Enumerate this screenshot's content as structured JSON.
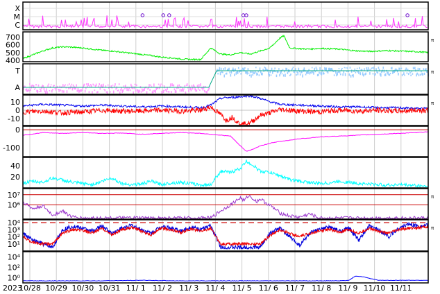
{
  "chart_data": {
    "type": "line",
    "x_axis": {
      "year_label": "2023",
      "tick_labels": [
        "10/28",
        "10/29",
        "10/30",
        "10/31",
        "11/ 1",
        "11/ 2",
        "11/ 3",
        "11/ 4",
        "11/ 5",
        "11/ 6",
        "11/ 7",
        "11/ 8",
        "11/ 9",
        "11/10",
        "11/11"
      ],
      "range": [
        "2023-10-27",
        "2023-11-11 12:00"
      ]
    },
    "grid": true,
    "panels": [
      {
        "id": "xray-flare-class",
        "type": "line",
        "tick_labels": [
          "X",
          "M",
          "C"
        ],
        "right_label": "",
        "colors": {
          "line": "#ff33ff",
          "marker": "#6600cc"
        },
        "flare_markers_x": [
          6.05,
          7.1,
          7.4,
          11.15,
          11.3,
          19.45
        ],
        "series": [
          {
            "name": "",
            "y_level": "C",
            "peaks_above_c": true
          }
        ]
      },
      {
        "id": "solar-wind-speed",
        "type": "line",
        "tick_labels": [
          "700",
          "600",
          "500",
          "400"
        ],
        "ylim": [
          380,
          770
        ],
        "right_label": "π",
        "colors": {
          "line": "#00ee00"
        },
        "series": [
          {
            "name": "",
            "x": [
              0,
              0.5,
              1.0,
              1.5,
              2.0,
              2.5,
              3.0,
              3.5,
              4.0,
              4.5,
              5.0,
              5.5,
              6.0,
              6.5,
              7.0,
              7.5,
              8.0,
              8.5,
              9.0,
              9.5,
              10.0,
              10.5,
              11.0,
              11.5,
              12.0,
              12.5,
              13.0,
              13.2,
              13.5,
              14.0,
              14.5,
              15.0,
              15.5,
              16.0,
              16.5,
              17.0,
              17.5,
              18.0,
              18.5,
              19.0,
              19.5,
              20.0,
              20.5
            ],
            "y": [
              420,
              470,
              520,
              560,
              575,
              570,
              560,
              545,
              530,
              520,
              505,
              490,
              475,
              460,
              440,
              430,
              415,
              410,
              410,
              560,
              480,
              470,
              500,
              480,
              520,
              560,
              690,
              720,
              560,
              550,
              545,
              555,
              550,
              545,
              530,
              520,
              515,
              520,
              525,
              520,
              515,
              510,
              500
            ]
          }
        ]
      },
      {
        "id": "imf-sector",
        "type": "scatter",
        "tick_labels": [
          "T",
          "A"
        ],
        "right_label": "π",
        "colors": {
          "t": "#99ccff",
          "a": "#ff99ff",
          "boundary": "#00aa88"
        },
        "series": [
          {
            "name": "",
            "x_range": [
              0,
              9.4
            ],
            "level": "A"
          },
          {
            "name": "",
            "x_range": [
              9.8,
              20.5
            ],
            "level": "T"
          }
        ]
      },
      {
        "id": "imf-components",
        "type": "line",
        "tick_labels": [
          "10",
          "0",
          "-10"
        ],
        "ylim": [
          -18,
          18
        ],
        "right_label": "π",
        "colors": {
          "total": "#0000ee",
          "bz": "#ff0000"
        },
        "series": [
          {
            "name": "",
            "x": [
              0,
              1,
              2,
              3,
              4,
              5,
              6,
              7,
              8,
              9,
              9.5,
              10,
              10.3,
              10.6,
              11,
              11.5,
              12,
              12.5,
              13,
              14,
              15,
              16,
              17,
              18,
              19,
              20,
              20.5
            ],
            "y": [
              5,
              7,
              6,
              5,
              6,
              5,
              4,
              5,
              4,
              3,
              6,
              14,
              15,
              15,
              16,
              17,
              14,
              10,
              7,
              6,
              5,
              4,
              4,
              3,
              3,
              2,
              2
            ]
          },
          {
            "name": "",
            "x": [
              0,
              1,
              2,
              3,
              4,
              5,
              6,
              7,
              8,
              9,
              9.5,
              10,
              10.3,
              10.6,
              11,
              11.5,
              12,
              12.5,
              13,
              14,
              15,
              16,
              17,
              18,
              19,
              20,
              20.5
            ],
            "y": [
              -2,
              -1,
              -3,
              -2,
              0,
              -1,
              -1,
              0,
              -1,
              0,
              4,
              -5,
              -12,
              -8,
              -17,
              -15,
              -6,
              -3,
              1,
              -1,
              -2,
              0,
              -1,
              0,
              -1,
              0,
              0
            ]
          }
        ]
      },
      {
        "id": "dst-index",
        "type": "line",
        "tick_labels": [
          "0",
          "-100"
        ],
        "ylim": [
          -150,
          20
        ],
        "right_label": "",
        "colors": {
          "line": "#ff00ff",
          "zero_line": "#cc0000"
        },
        "series": [
          {
            "name": "",
            "x": [
              0,
              0.5,
              1,
              2,
              3,
              4,
              5,
              6,
              7,
              8,
              9,
              9.5,
              10,
              10.5,
              11,
              11.3,
              11.6,
              12,
              12.5,
              13,
              14,
              15,
              16,
              17,
              18,
              19,
              20,
              20.5
            ],
            "y": [
              -30,
              -25,
              -15,
              -20,
              -15,
              -20,
              -18,
              -25,
              -20,
              -15,
              -20,
              -25,
              -30,
              -35,
              -90,
              -120,
              -110,
              -90,
              -75,
              -65,
              -50,
              -40,
              -35,
              -30,
              -25,
              -20,
              -15,
              -10
            ]
          }
        ]
      },
      {
        "id": "kp-like",
        "type": "line",
        "tick_labels": [
          "40",
          "20"
        ],
        "ylim": [
          0,
          55
        ],
        "right_label": "",
        "colors": {
          "line": "#00ffff"
        },
        "series": [
          {
            "name": "",
            "x": [
              0,
              0.5,
              1,
              1.5,
              2,
              2.5,
              3,
              3.5,
              4,
              4.5,
              5,
              5.5,
              6,
              6.5,
              7,
              7.5,
              8,
              8.5,
              9,
              9.5,
              10,
              10.5,
              11,
              11.3,
              11.6,
              12,
              12.5,
              13,
              13.5,
              14,
              14.5,
              15,
              15.5,
              16,
              16.5,
              17,
              17.5,
              18,
              18.5,
              19,
              19.5,
              20,
              20.5
            ],
            "y": [
              8,
              12,
              10,
              18,
              14,
              10,
              8,
              6,
              12,
              18,
              8,
              6,
              7,
              12,
              6,
              9,
              10,
              8,
              5,
              6,
              30,
              28,
              35,
              48,
              42,
              30,
              28,
              22,
              15,
              12,
              10,
              8,
              9,
              12,
              10,
              8,
              7,
              6,
              5,
              6,
              5,
              4,
              3
            ]
          }
        ]
      },
      {
        "id": "proton-flux",
        "type": "line",
        "tick_labels": [
          "10⁷",
          "10⁶"
        ],
        "ylim_log10": [
          4.6,
          7.6
        ],
        "threshold_log10": [
          7.0,
          6.0
        ],
        "right_label": "π",
        "colors": {
          "line": "#9933cc",
          "threshold": "#cc0000"
        },
        "series": [
          {
            "name": "",
            "x": [
              0,
              0.5,
              1,
              1.5,
              2,
              2.5,
              3,
              9.5,
              10,
              10.5,
              11,
              11.2,
              11.4,
              11.6,
              11.8,
              12,
              12.3,
              12.6,
              13,
              13.5,
              14,
              14.5,
              15,
              20.5
            ],
            "y": [
              6.3,
              5.6,
              5.9,
              5.0,
              5.4,
              4.8,
              4.7,
              4.7,
              5.4,
              6.0,
              6.7,
              6.4,
              6.9,
              6.7,
              6.3,
              6.6,
              6.2,
              5.8,
              5.2,
              4.9,
              4.8,
              5.1,
              4.7,
              4.7
            ]
          }
        ]
      },
      {
        "id": "electron-flux",
        "type": "line",
        "tick_labels": [
          "10⁴",
          "10³",
          "10²",
          "10¹"
        ],
        "ylim_log10": [
          0,
          4.4
        ],
        "threshold_log10": 4.0,
        "right_label": "π",
        "colors": {
          "blue": "#0000dd",
          "red": "#ee0000",
          "threshold": "#cc0000"
        },
        "series": [
          {
            "name": "",
            "x": [
              0,
              0.5,
              1,
              1.5,
              2,
              2.5,
              3,
              3.5,
              4,
              4.5,
              5,
              5.5,
              6,
              6.5,
              7,
              7.5,
              8,
              8.5,
              9,
              9.5,
              10,
              12,
              12.5,
              13,
              13.5,
              14,
              14.5,
              15,
              15.5,
              16,
              16.5,
              17,
              17.5,
              18,
              18.5,
              19,
              19.5,
              20,
              20.5
            ],
            "y": [
              2.5,
              1.5,
              1.0,
              0.5,
              3.0,
              3.5,
              3.2,
              2.8,
              3.5,
              2.5,
              3.2,
              3.6,
              3.0,
              2.5,
              3.5,
              3.2,
              2.8,
              3.4,
              3.0,
              3.6,
              0.5,
              0.5,
              2.5,
              3.2,
              2.0,
              0.8,
              2.5,
              3.0,
              3.4,
              2.8,
              3.2,
              1.5,
              3.5,
              3.0,
              2.0,
              3.2,
              3.8,
              3.5,
              3.6
            ]
          },
          {
            "name": "",
            "x": [
              0,
              0.5,
              1,
              1.5,
              2,
              2.5,
              3,
              3.5,
              4,
              4.5,
              5,
              5.5,
              6,
              6.5,
              7,
              7.5,
              8,
              8.5,
              9,
              9.5,
              10,
              12,
              12.5,
              13,
              13.5,
              14,
              14.5,
              15,
              15.5,
              16,
              16.5,
              17,
              17.5,
              18,
              18.5,
              19,
              19.5,
              20,
              20.5
            ],
            "y": [
              2.0,
              1.2,
              1.0,
              1.0,
              2.5,
              3.0,
              2.9,
              2.5,
              3.2,
              2.3,
              3.0,
              3.3,
              2.8,
              2.3,
              3.2,
              3.0,
              2.6,
              3.1,
              2.8,
              3.2,
              1.0,
              1.0,
              2.2,
              3.0,
              2.5,
              2.0,
              2.5,
              2.8,
              3.1,
              2.6,
              3.0,
              2.5,
              3.2,
              2.8,
              2.5,
              3.0,
              3.2,
              3.3,
              3.4
            ]
          }
        ]
      },
      {
        "id": "neutron-flux",
        "type": "line",
        "tick_labels": [
          "10⁴",
          "10²",
          "10⁰"
        ],
        "ylim_log10": [
          -1,
          5
        ],
        "right_label": "",
        "colors": {
          "line": "#0000ff"
        },
        "series": [
          {
            "name": "",
            "x": [
              0,
              2,
              4,
              6,
              8,
              10,
              12,
              14,
              16,
              16.5,
              16.8,
              17.2,
              17.6,
              18,
              20.5
            ],
            "y": [
              -0.6,
              -0.6,
              -0.6,
              -0.5,
              -0.6,
              -0.6,
              -0.6,
              -0.6,
              -0.6,
              -0.5,
              0.3,
              0.2,
              -0.2,
              -0.5,
              -0.5
            ]
          }
        ]
      }
    ]
  }
}
